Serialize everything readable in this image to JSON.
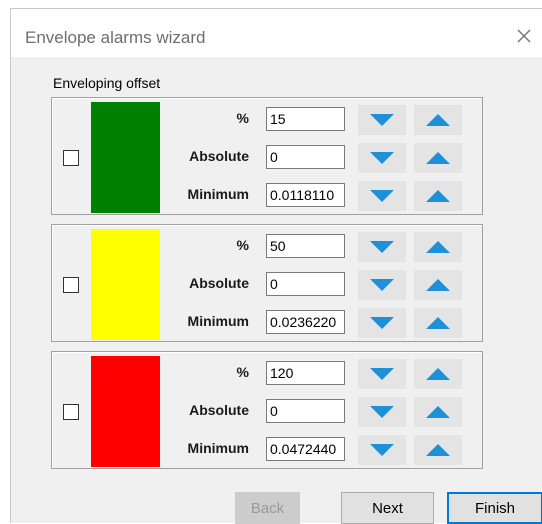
{
  "window": {
    "title": "Envelope alarms wizard",
    "close_icon": "close-icon"
  },
  "group_label": "Enveloping offset",
  "labels": {
    "percent": "%",
    "absolute": "Absolute",
    "minimum": "Minimum"
  },
  "bands": [
    {
      "color": "#008000",
      "checked": false,
      "percent": "15",
      "absolute": "0",
      "minimum": "0.0118110"
    },
    {
      "color": "#ffff00",
      "checked": false,
      "percent": "50",
      "absolute": "0",
      "minimum": "0.0236220"
    },
    {
      "color": "#ff0000",
      "checked": false,
      "percent": "120",
      "absolute": "0",
      "minimum": "0.0472440"
    }
  ],
  "icons": {
    "down": "arrow-down-icon",
    "up": "arrow-up-icon",
    "arrow_color": "#1e90d8"
  },
  "footer": {
    "back_label": "Back",
    "next_label": "Next",
    "finish_label": "Finish"
  }
}
